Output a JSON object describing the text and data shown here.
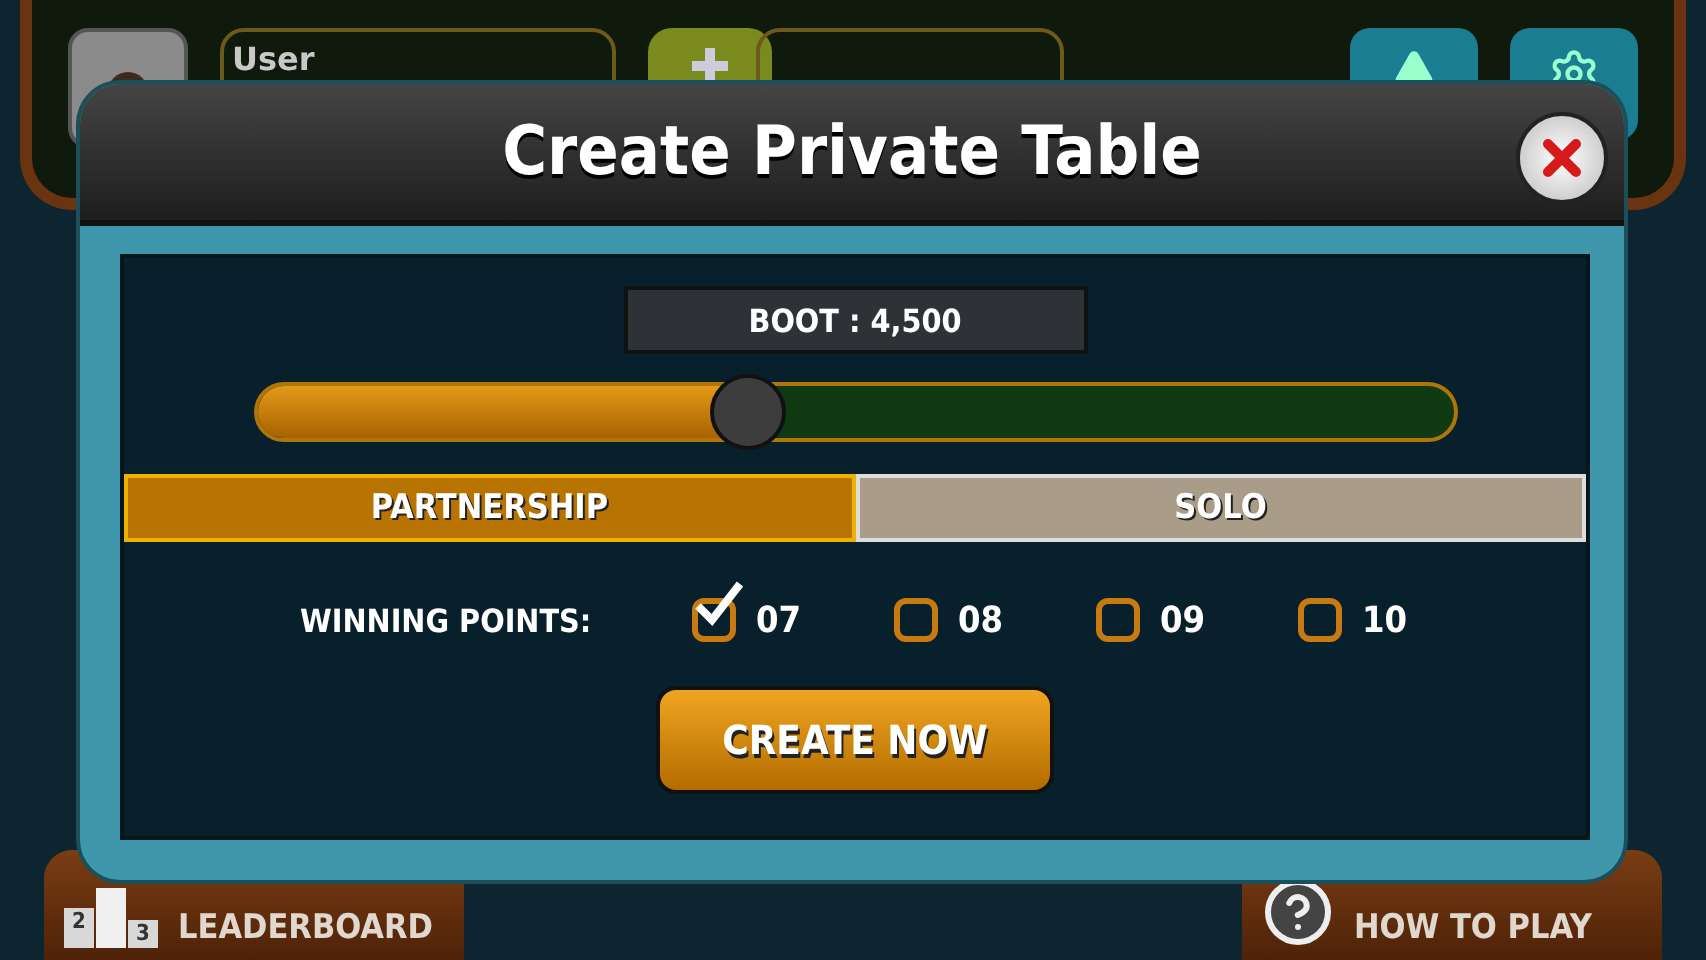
{
  "background": {
    "user_label": "User",
    "bottom_buttons": [
      {
        "kind": "podium",
        "label": "LEADERBOARD",
        "digits": [
          "2",
          "3"
        ]
      },
      {
        "kind": "help",
        "label": "HOW TO PLAY"
      }
    ]
  },
  "dialog": {
    "title": "Create Private Table",
    "boot": "BOOT : 4,500",
    "slider": {
      "level": 0.41
    },
    "modes": [
      {
        "label": "PARTNERSHIP",
        "selected": true
      },
      {
        "label": "SOLO",
        "selected": false
      }
    ],
    "winning_points": {
      "label": "WINNING POINTS:",
      "options": [
        {
          "label": "07",
          "checked": true
        },
        {
          "label": "08",
          "checked": false
        },
        {
          "label": "09",
          "checked": false
        },
        {
          "label": "10",
          "checked": false
        }
      ]
    },
    "create_button": "CREATE NOW"
  }
}
